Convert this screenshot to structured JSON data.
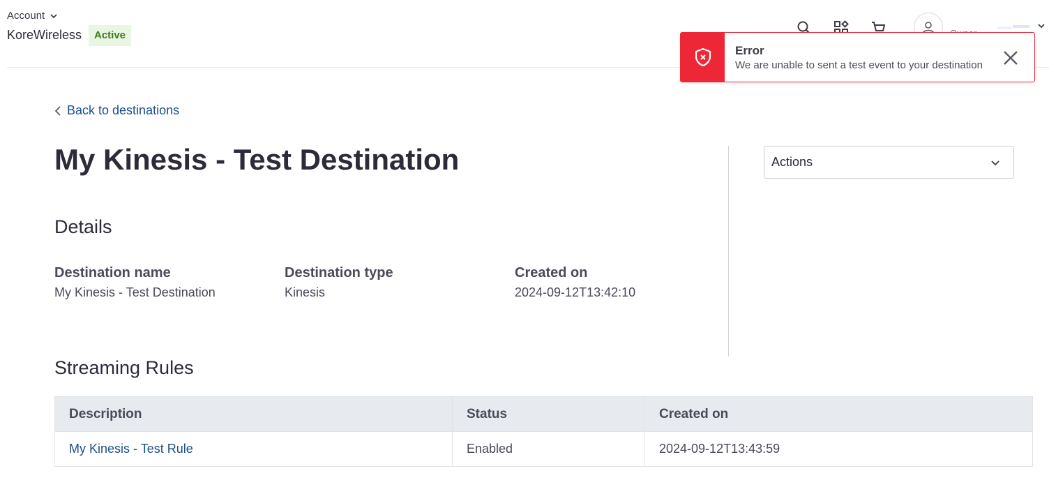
{
  "header": {
    "account_label": "Account",
    "account_name": "KoreWireless",
    "account_status": "Active",
    "owner_label": "Owner",
    "icons": [
      "search-icon",
      "apps-icon",
      "cart-icon",
      "user-icon",
      "chevron-down-icon"
    ]
  },
  "toast": {
    "title": "Error",
    "message": "We are unable to sent a test event to your destination",
    "color": "#ee2737",
    "icon": "shield-error-icon"
  },
  "nav": {
    "back_label": "Back to destinations"
  },
  "page": {
    "title": "My Kinesis - Test Destination"
  },
  "details": {
    "section_title": "Details",
    "fields": [
      {
        "label": "Destination name",
        "value": "My Kinesis - Test Destination"
      },
      {
        "label": "Destination type",
        "value": "Kinesis"
      },
      {
        "label": "Created on",
        "value": "2024-09-12T13:42:10"
      }
    ]
  },
  "actions": {
    "label": "Actions"
  },
  "streaming_rules": {
    "section_title": "Streaming Rules",
    "columns": [
      "Description",
      "Status",
      "Created on"
    ],
    "rows": [
      {
        "description": "My Kinesis - Test Rule",
        "status": "Enabled",
        "created_on": "2024-09-12T13:43:59"
      }
    ]
  },
  "colors": {
    "link": "#1d4f8c",
    "error": "#ee2737",
    "badge_bg": "#e9f6e1",
    "badge_text": "#3f7a1f"
  }
}
